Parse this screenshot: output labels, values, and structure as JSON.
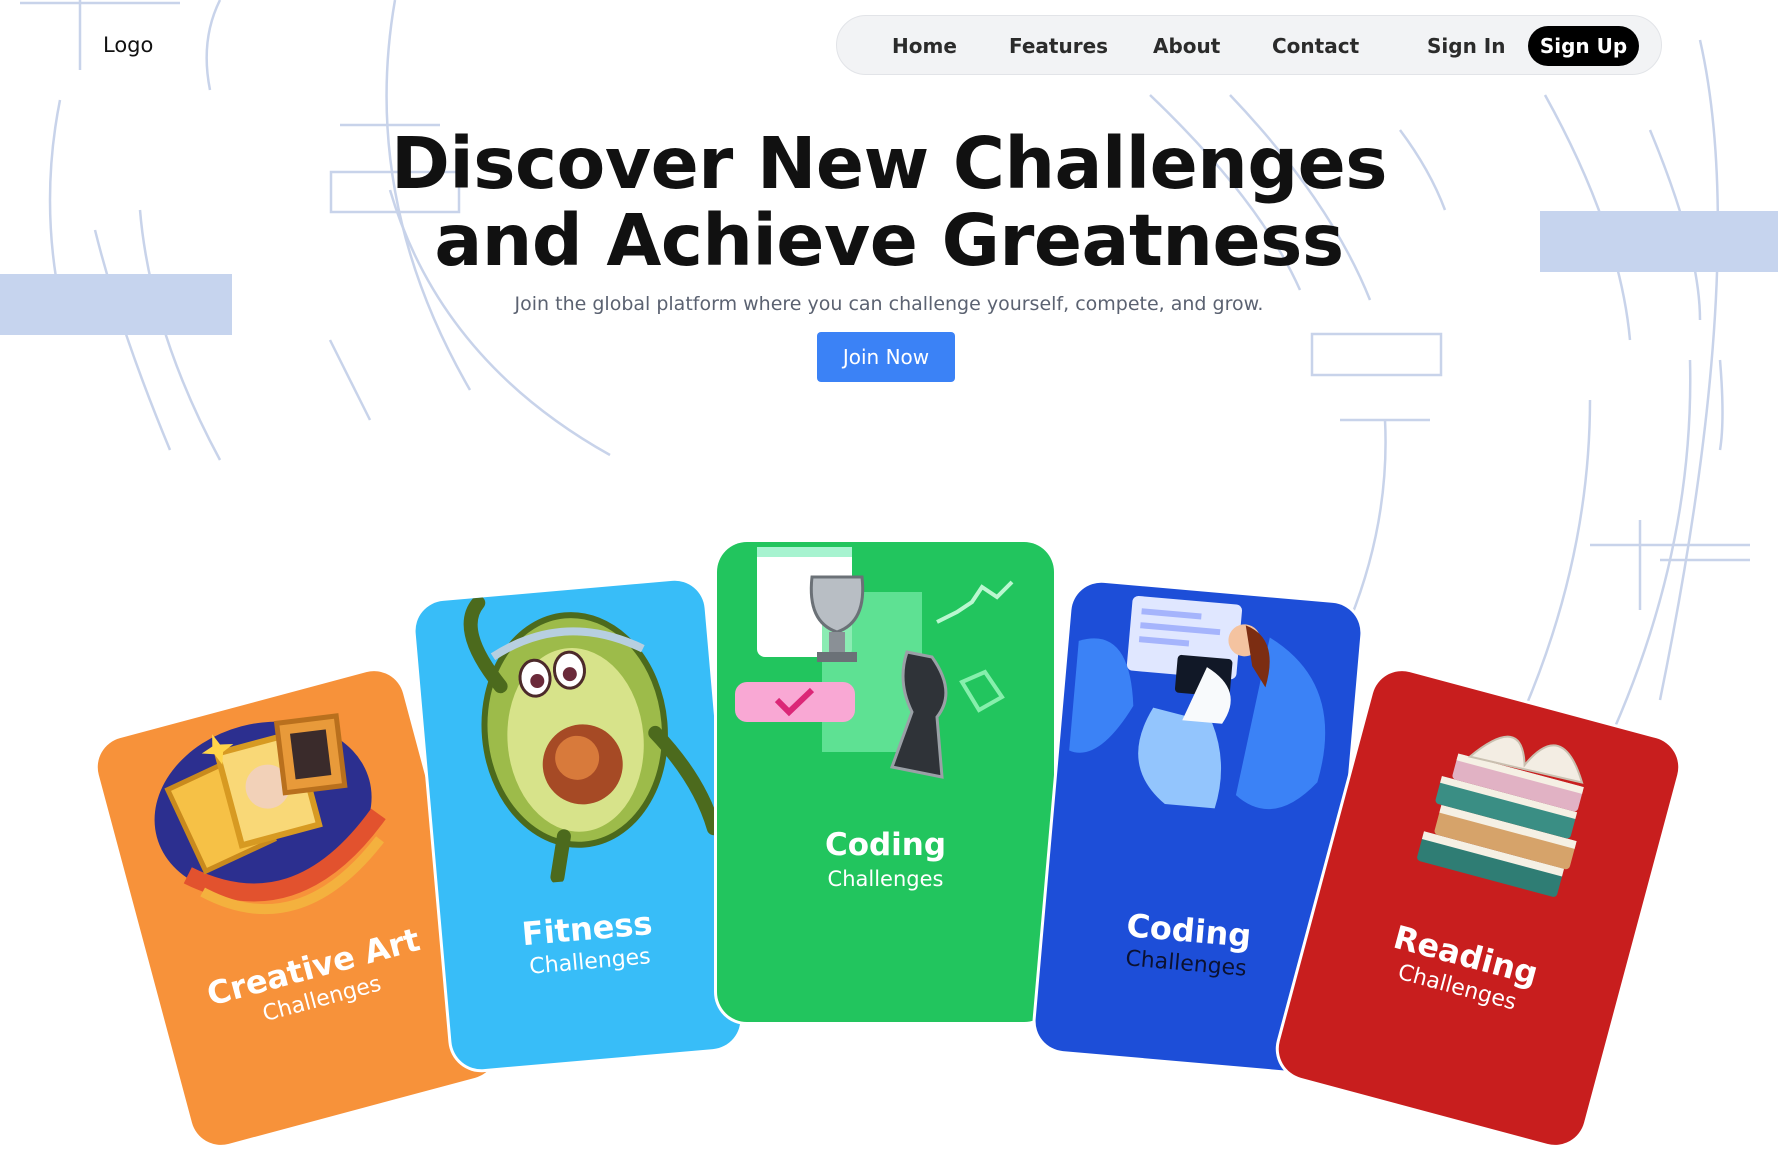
{
  "header": {
    "logo": "Logo",
    "nav": {
      "home": "Home",
      "features": "Features",
      "about": "About",
      "contact": "Contact",
      "sign_in": "Sign In",
      "sign_up": "Sign Up"
    }
  },
  "hero": {
    "title_line1": "Discover New Challenges",
    "title_line2": "and Achieve Greatness",
    "subtitle": "Join the global platform where you can challenge yourself, compete, and grow.",
    "cta": "Join Now"
  },
  "cards": [
    {
      "title": "Creative Art",
      "subtitle": "Challenges",
      "color": "#f7923a",
      "icon": "art-frames-icon"
    },
    {
      "title": "Fitness",
      "subtitle": "Challenges",
      "color": "#38bdf8",
      "icon": "avocado-workout-icon"
    },
    {
      "title": "Coding",
      "subtitle": "Challenges",
      "color": "#22c55e",
      "icon": "chess-trophy-icon"
    },
    {
      "title": "Coding",
      "subtitle": "Challenges",
      "color": "#1d4ed8",
      "icon": "laptop-person-icon"
    },
    {
      "title": "Reading",
      "subtitle": "Challenges",
      "color": "#c81e1e",
      "icon": "book-stack-icon"
    }
  ],
  "colors": {
    "accent": "#3b82f6",
    "decoration": "#c3d0eb"
  }
}
